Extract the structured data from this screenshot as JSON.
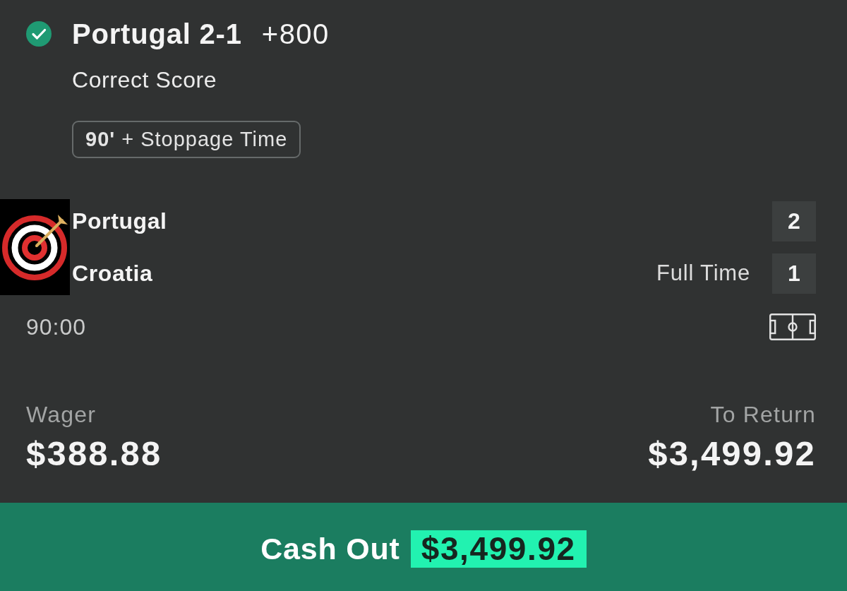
{
  "bet": {
    "settled": true,
    "selection": "Portugal 2-1",
    "odds": "+800",
    "market": "Correct Score",
    "badge": "**90'** + Stoppage Time"
  },
  "match": {
    "teams": [
      {
        "name": "Portugal",
        "score": "2"
      },
      {
        "name": "Croatia",
        "score": "1"
      }
    ],
    "status": "Full Time",
    "clock": "90:00"
  },
  "wager": {
    "label": "Wager",
    "amount": "$388.88"
  },
  "to_return": {
    "label": "To Return",
    "amount": "$3,499.92"
  },
  "cash_out": {
    "label": "Cash Out",
    "amount": "$3,499.92"
  }
}
